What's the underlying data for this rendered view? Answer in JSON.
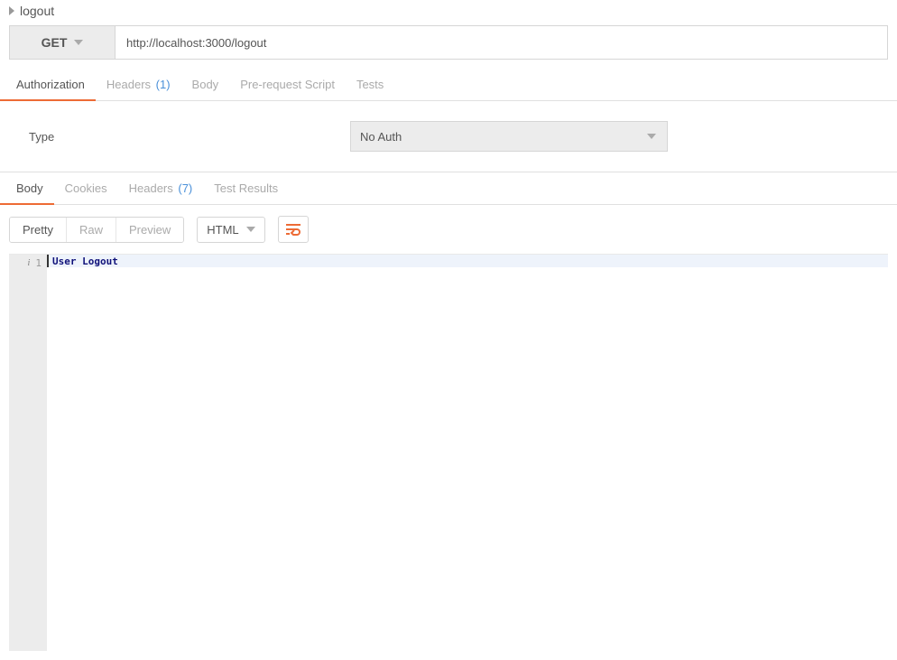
{
  "header": {
    "name": "logout"
  },
  "request": {
    "method": "GET",
    "url": "http://localhost:3000/logout"
  },
  "req_tabs": {
    "authorization": "Authorization",
    "headers": "Headers",
    "headers_count": "(1)",
    "body": "Body",
    "prerequest": "Pre-request Script",
    "tests": "Tests"
  },
  "auth": {
    "type_label": "Type",
    "selected": "No Auth"
  },
  "res_tabs": {
    "body": "Body",
    "cookies": "Cookies",
    "headers": "Headers",
    "headers_count": "(7)",
    "test_results": "Test Results"
  },
  "view": {
    "pretty": "Pretty",
    "raw": "Raw",
    "preview": "Preview",
    "format": "HTML"
  },
  "response": {
    "line_no": "1",
    "content": "User Logout"
  }
}
